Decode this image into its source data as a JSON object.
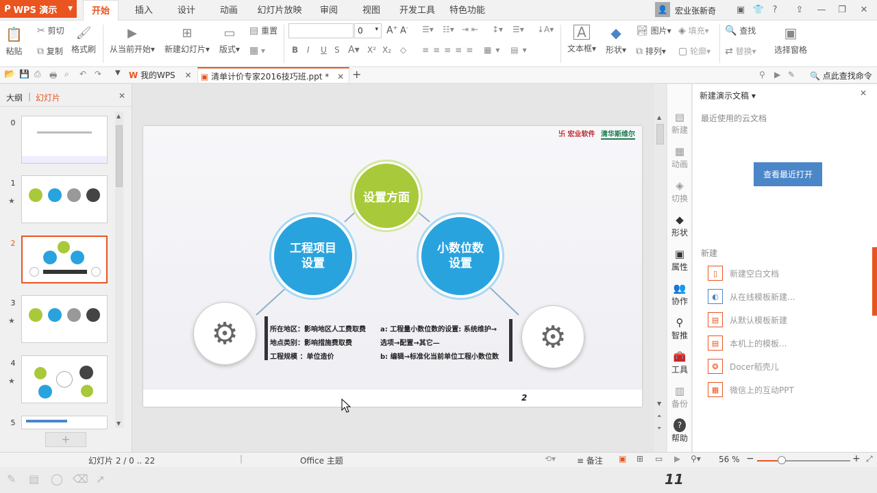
{
  "app": {
    "name": "WPS 演示"
  },
  "menu_tabs": [
    "开始",
    "插入",
    "设计",
    "动画",
    "幻灯片放映",
    "审阅",
    "视图",
    "开发工具",
    "特色功能"
  ],
  "user": {
    "name": "宏业张新奇"
  },
  "title_icons": [
    "shirt-icon",
    "help-icon"
  ],
  "ribbon": {
    "paste": "粘贴",
    "cut": "剪切",
    "copy": "复制",
    "format_painter": "格式刷",
    "from_current": "从当前开始",
    "new_slide": "新建幻灯片",
    "layout": "版式",
    "reset": "重置",
    "font_size": "0",
    "textbox": "文本框",
    "shape": "形状",
    "picture": "图片",
    "fill": "填充",
    "arrange": "排列",
    "outline": "轮廓",
    "find": "查找",
    "replace": "替换",
    "select_pane": "选择窗格"
  },
  "doc_tabs": {
    "home": "我的WPS",
    "current": "清单计价专家2016技巧班.ppt *"
  },
  "find_command": "点此查找命令",
  "left_panel": {
    "outline_tab": "大纲",
    "slides_tab": "幻灯片",
    "slide_numbers": [
      "0",
      "1",
      "2",
      "3",
      "4",
      "5"
    ]
  },
  "slide": {
    "logo_left": "宏业软件",
    "logo_right": "清华斯维尔",
    "top_circle": "设置方面",
    "left_circle_line1": "工程项目",
    "left_circle_line2": "设置",
    "right_circle_line1": "小数位数",
    "right_circle_line2": "设置",
    "left_text": [
      "所在地区：影响地区人工费取费",
      "地点类别：影响措施费取费",
      "工程规模  ：单位造价"
    ],
    "right_text": [
      "a: 工程量小数位数的设置: 系统维护→",
      "选项→配置→其它—",
      "b: 编辑→标准化当前单位工程小数位数"
    ],
    "page_number": "2"
  },
  "right_rail": [
    {
      "label": "新建",
      "icon": "new-icon",
      "dim": true
    },
    {
      "label": "动画",
      "icon": "animation-icon",
      "dim": true
    },
    {
      "label": "切换",
      "icon": "transition-icon",
      "dim": true
    },
    {
      "label": "形状",
      "icon": "shape-icon",
      "dim": false
    },
    {
      "label": "属性",
      "icon": "property-icon",
      "dim": false
    },
    {
      "label": "协作",
      "icon": "collab-icon",
      "dim": false
    },
    {
      "label": "智推",
      "icon": "recommend-icon",
      "dim": false
    },
    {
      "label": "工具",
      "icon": "toolbox-icon",
      "dim": false
    },
    {
      "label": "备份",
      "icon": "backup-icon",
      "dim": true
    },
    {
      "label": "帮助",
      "icon": "help-icon",
      "dim": false
    }
  ],
  "task_pane": {
    "title": "新建演示文稿",
    "recent_cloud": "最近使用的云文档",
    "view_recent_button": "查看最近打开",
    "new_section": "新建",
    "items": [
      "新建空白文档",
      "从在线模板新建...",
      "从默认模板新建",
      "本机上的模板...",
      "Docer稻壳儿",
      "微信上的互动PPT"
    ]
  },
  "status": {
    "slide_info": "幻灯片 2 / 0 .. 22",
    "theme": "Office 主题",
    "notes": "备注",
    "zoom": "56 %"
  },
  "bottom_number": "11",
  "colors": {
    "accent": "#e9541f",
    "blue_circle": "#29a3de",
    "green_circle": "#a8c93a",
    "button_blue": "#4a86c8"
  }
}
